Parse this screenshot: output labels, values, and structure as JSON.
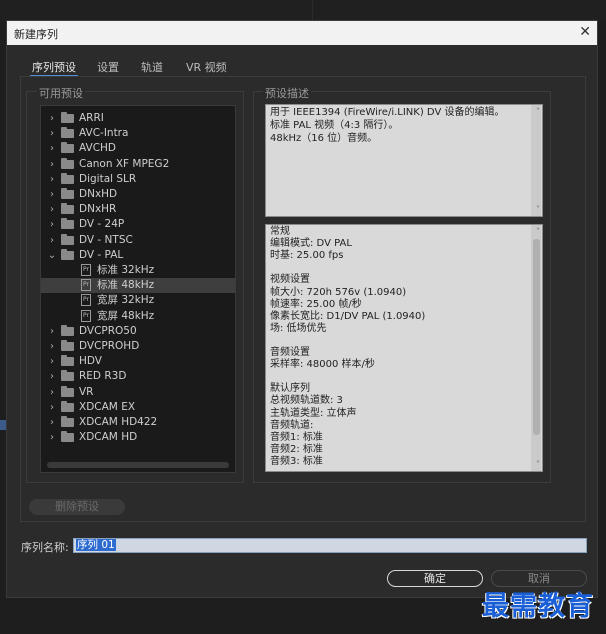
{
  "dialog": {
    "title": "新建序列"
  },
  "tabs": [
    {
      "label": "序列预设"
    },
    {
      "label": "设置"
    },
    {
      "label": "轨道"
    },
    {
      "label": "VR 视频"
    }
  ],
  "available_presets": {
    "label": "可用预设",
    "items": [
      {
        "label": "ARRI",
        "expanded": false
      },
      {
        "label": "AVC-Intra",
        "expanded": false
      },
      {
        "label": "AVCHD",
        "expanded": false
      },
      {
        "label": "Canon XF MPEG2",
        "expanded": false
      },
      {
        "label": "Digital SLR",
        "expanded": false
      },
      {
        "label": "DNxHD",
        "expanded": false
      },
      {
        "label": "DNxHR",
        "expanded": false
      },
      {
        "label": "DV - 24P",
        "expanded": false
      },
      {
        "label": "DV - NTSC",
        "expanded": false
      },
      {
        "label": "DV - PAL",
        "expanded": true
      },
      {
        "label": "标准 32kHz",
        "child": true
      },
      {
        "label": "标准 48kHz",
        "child": true,
        "selected": true
      },
      {
        "label": "宽屏 32kHz",
        "child": true
      },
      {
        "label": "宽屏 48kHz",
        "child": true
      },
      {
        "label": "DVCPRO50",
        "expanded": false
      },
      {
        "label": "DVCPROHD",
        "expanded": false
      },
      {
        "label": "HDV",
        "expanded": false
      },
      {
        "label": "RED R3D",
        "expanded": false
      },
      {
        "label": "VR",
        "expanded": false
      },
      {
        "label": "XDCAM EX",
        "expanded": false
      },
      {
        "label": "XDCAM HD422",
        "expanded": false
      },
      {
        "label": "XDCAM HD",
        "expanded": false
      }
    ],
    "delete_button": "删除预设"
  },
  "preset_description": {
    "label": "预设描述",
    "lines": [
      "用于 IEEE1394 (FireWire/i.LINK) DV 设备的编辑。",
      "标准 PAL 视频（4:3 隔行）。",
      "48kHz（16 位）音频。"
    ]
  },
  "details": {
    "lines": [
      "常规",
      " 编辑模式: DV PAL",
      " 时基: 25.00 fps",
      "",
      "视频设置",
      " 帧大小: 720h 576v (1.0940)",
      " 帧速率: 25.00  帧/秒",
      " 像素长宽比: D1/DV PAL (1.0940)",
      " 场: 低场优先",
      "",
      "音频设置",
      " 采样率: 48000 样本/秒",
      "",
      "默认序列",
      " 总视频轨道数: 3",
      " 主轨道类型: 立体声",
      " 音频轨道:",
      " 音频1: 标准",
      " 音频2: 标准",
      " 音频3: 标准"
    ]
  },
  "sequence_name": {
    "label": "序列名称:",
    "value": "序列 01"
  },
  "buttons": {
    "ok": "确定",
    "cancel": "取消"
  },
  "watermark": "最需教育",
  "colors": {
    "accent": "#4a8fd7",
    "watermark": "#1a5fd6"
  }
}
